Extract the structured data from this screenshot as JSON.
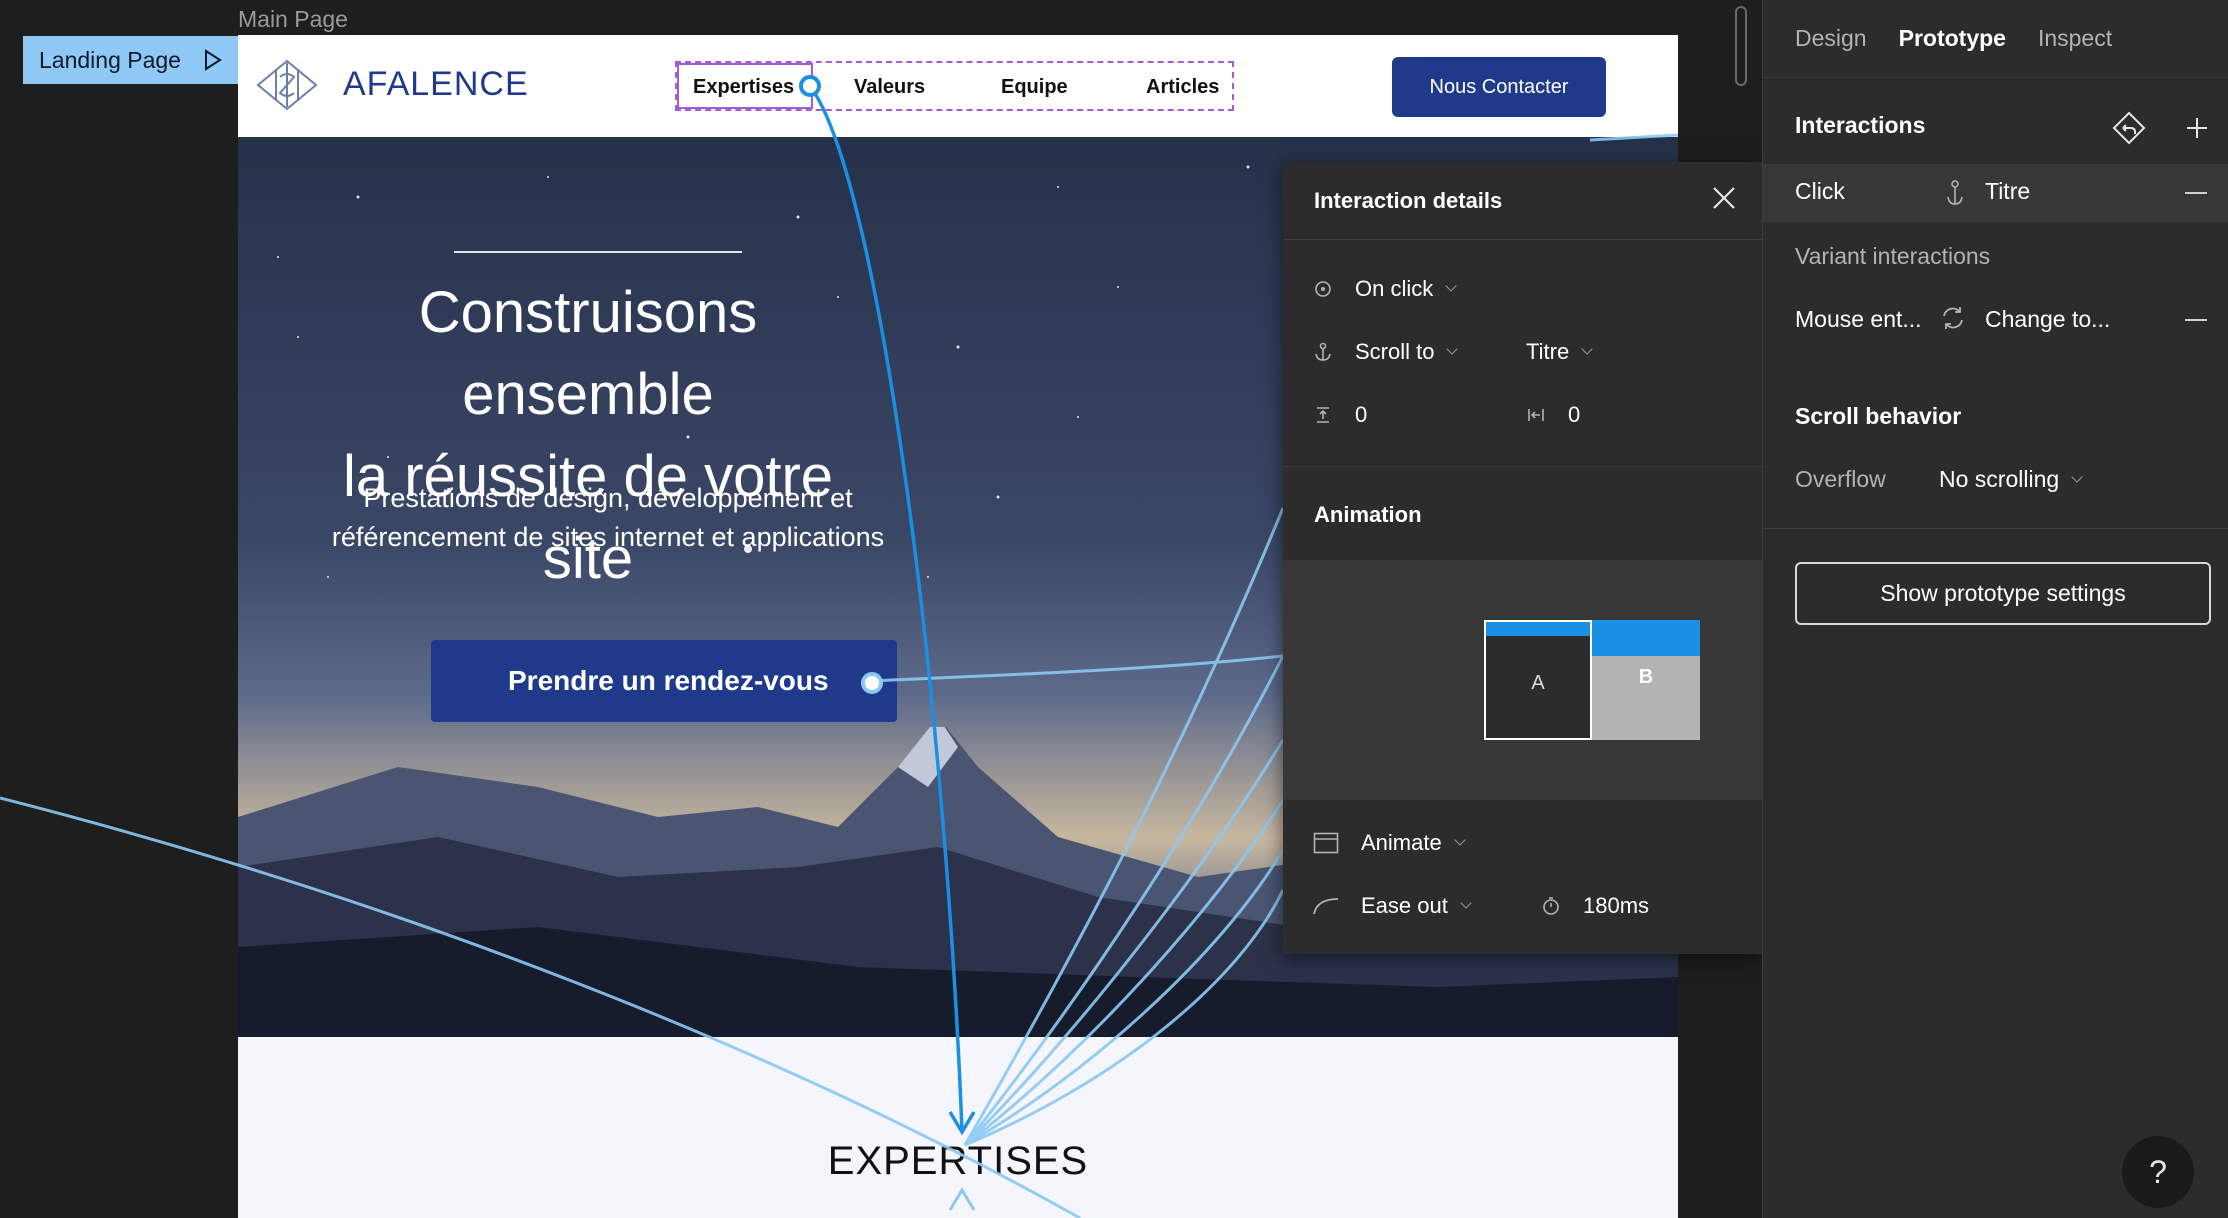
{
  "canvas": {
    "frame_label": "Main Page",
    "flow_start_label": "Landing Page"
  },
  "site": {
    "brand": "AFALENCE",
    "nav": [
      "Expertises",
      "Valeurs",
      "Equipe",
      "Articles"
    ],
    "contact_button": "Nous Contacter",
    "hero_title_line1": "Construisons ensemble",
    "hero_title_line2": "la réussite de votre site",
    "hero_subtitle_line1": "Prestations de design, développement et",
    "hero_subtitle_line2": "référencement de sites internet et applications",
    "hero_cta": "Prendre un rendez-vous",
    "section_title": "EXPERTISES"
  },
  "interaction_details": {
    "title": "Interaction details",
    "trigger": "On click",
    "action": "Scroll to",
    "destination": "Titre",
    "offset_y": "0",
    "offset_x": "0",
    "animation_heading": "Animation",
    "box_a": "A",
    "box_b": "B",
    "animation_type": "Animate",
    "easing": "Ease out",
    "duration": "180ms"
  },
  "right_panel": {
    "tabs": [
      "Design",
      "Prototype",
      "Inspect"
    ],
    "active_tab": "Prototype",
    "interactions_heading": "Interactions",
    "click_trigger": "Click",
    "click_target": "Titre",
    "variant_heading": "Variant interactions",
    "variant_trigger": "Mouse ent...",
    "variant_action": "Change to...",
    "scroll_heading": "Scroll behavior",
    "overflow_label": "Overflow",
    "overflow_value": "No scrolling",
    "show_settings_button": "Show prototype settings"
  },
  "help_label": "?",
  "colors": {
    "accent": "#1a8fe3",
    "brand_navy": "#1f3a8a",
    "selection": "#a35bd8",
    "panel_bg": "#2c2c2c"
  }
}
